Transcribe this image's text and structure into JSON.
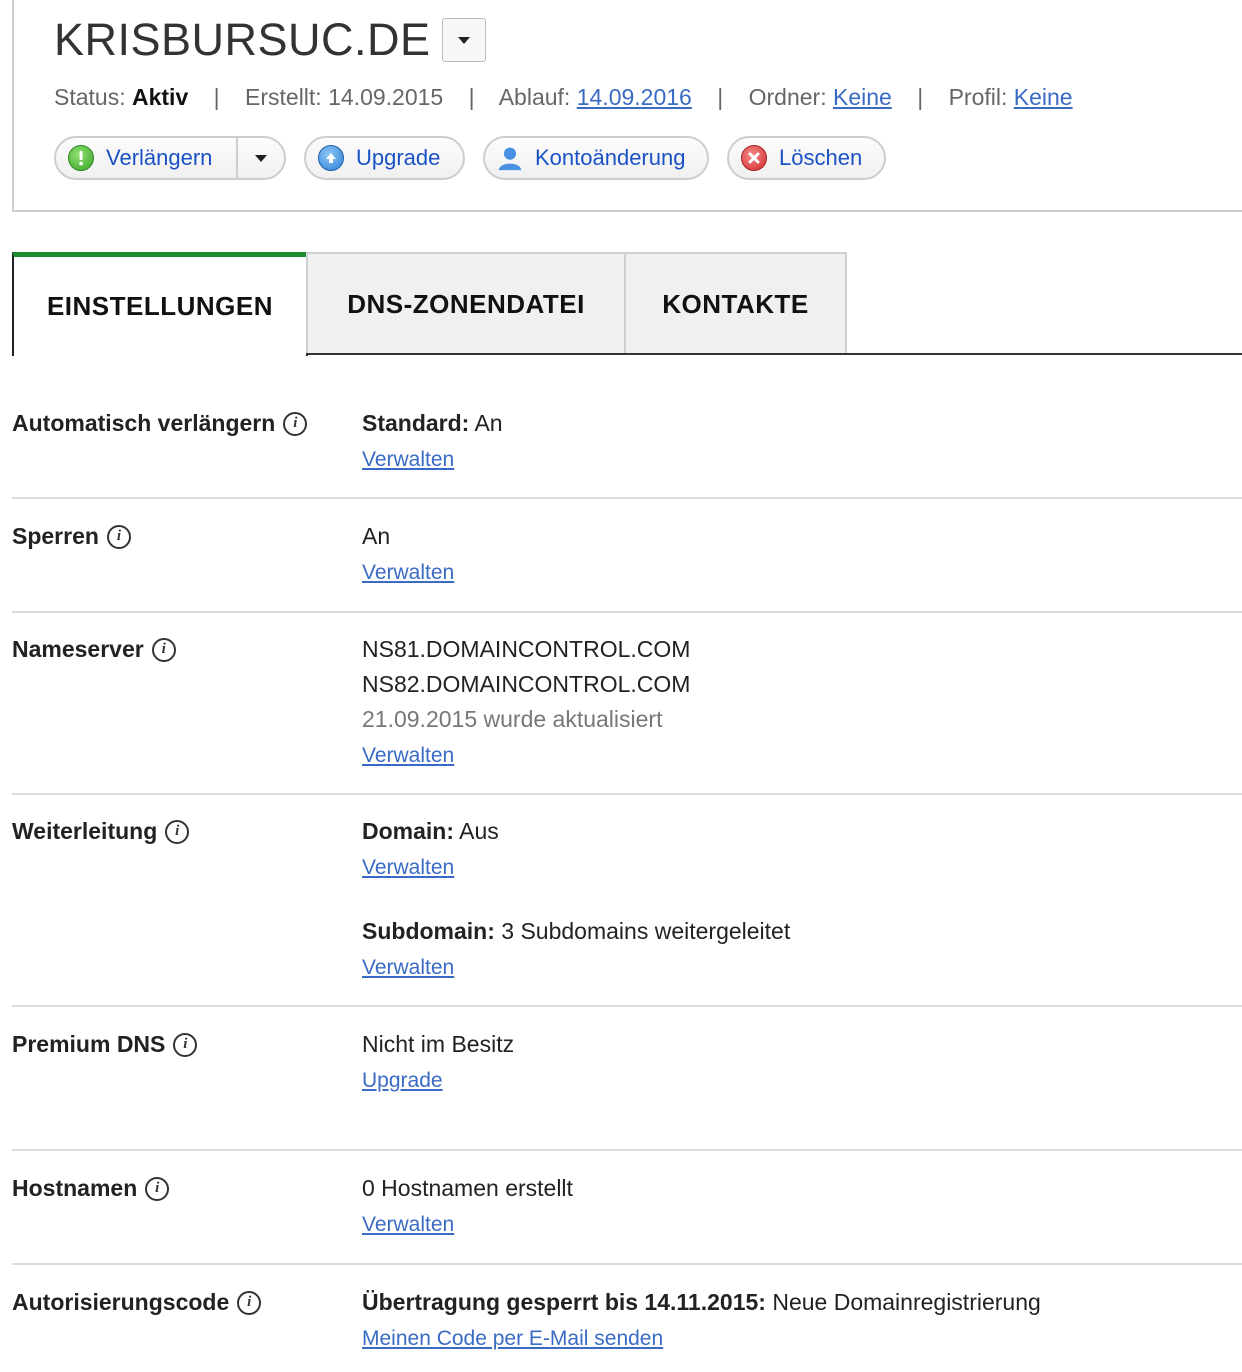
{
  "domain": {
    "name": "KRISBURSUC.DE"
  },
  "meta": {
    "status_label": "Status:",
    "status_value": "Aktiv",
    "created_label": "Erstellt:",
    "created_value": "14.09.2015",
    "expiry_label": "Ablauf:",
    "expiry_value": "14.09.2016",
    "folder_label": "Ordner:",
    "folder_value": "Keine",
    "profile_label": "Profil:",
    "profile_value": "Keine",
    "separator": "|"
  },
  "actions": {
    "renew": "Verlängern",
    "upgrade": "Upgrade",
    "account_change": "Kontoänderung",
    "delete": "Löschen"
  },
  "tabs": [
    "EINSTELLUNGEN",
    "DNS-ZONENDATEI",
    "KONTAKTE"
  ],
  "settings": {
    "autorenew": {
      "label": "Automatisch verlängern",
      "key": "Standard:",
      "value": "An",
      "link": "Verwalten"
    },
    "lock": {
      "label": "Sperren",
      "value": "An",
      "link": "Verwalten"
    },
    "nameserver": {
      "label": "Nameserver",
      "ns1": "NS81.DOMAINCONTROL.COM",
      "ns2": "NS82.DOMAINCONTROL.COM",
      "updated": "21.09.2015 wurde aktualisiert",
      "link": "Verwalten"
    },
    "forwarding": {
      "label": "Weiterleitung",
      "domain_key": "Domain:",
      "domain_value": "Aus",
      "domain_link": "Verwalten",
      "sub_key": "Subdomain:",
      "sub_value": "3 Subdomains weitergeleitet",
      "sub_link": "Verwalten"
    },
    "premium_dns": {
      "label": "Premium DNS",
      "value": "Nicht im Besitz",
      "link": "Upgrade"
    },
    "hostnames": {
      "label": "Hostnamen",
      "value": "0 Hostnamen erstellt",
      "link": "Verwalten"
    },
    "authcode": {
      "label": "Autorisierungscode",
      "key": "Übertragung gesperrt bis 14.11.2015:",
      "value": "Neue Domainregistrierung",
      "link": "Meinen Code per E-Mail senden"
    }
  },
  "colors": {
    "accent_green": "#1c8c2e",
    "link_blue": "#3a6bc4",
    "button_text": "#1a52c6"
  },
  "icons": {
    "info": "i",
    "renew": "exclamation-green",
    "upgrade": "arrow-up-blue",
    "account": "person-blue",
    "delete": "x-red"
  }
}
